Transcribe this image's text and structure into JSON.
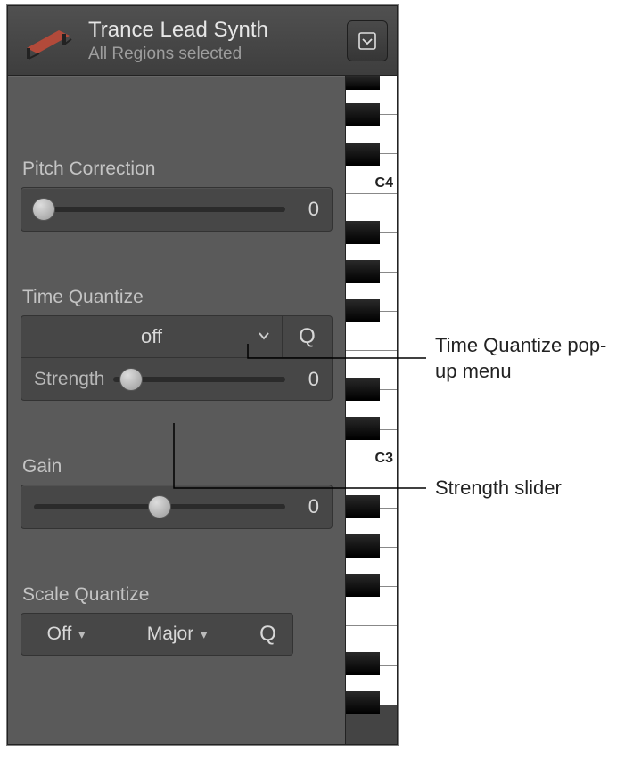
{
  "header": {
    "track_title": "Trance Lead Synth",
    "subtitle": "All Regions selected",
    "icon": "keyboard-instrument-icon",
    "view_button_icon": "dropdown-icon"
  },
  "pitch_correction": {
    "label": "Pitch Correction",
    "value": "0",
    "knob_pct": 4
  },
  "time_quantize": {
    "label": "Time Quantize",
    "popup_value": "off",
    "q_button": "Q",
    "strength_label": "Strength",
    "strength_value": "0",
    "strength_knob_pct": 10
  },
  "gain": {
    "label": "Gain",
    "value": "0",
    "knob_pct": 50
  },
  "scale_quantize": {
    "label": "Scale Quantize",
    "root_value": "Off",
    "scale_value": "Major",
    "q_button": "Q"
  },
  "keyboard": {
    "labels": {
      "c4": "C4",
      "c3": "C3"
    }
  },
  "callouts": {
    "tq_popup": "Time Quantize pop-up menu",
    "strength": "Strength slider"
  }
}
